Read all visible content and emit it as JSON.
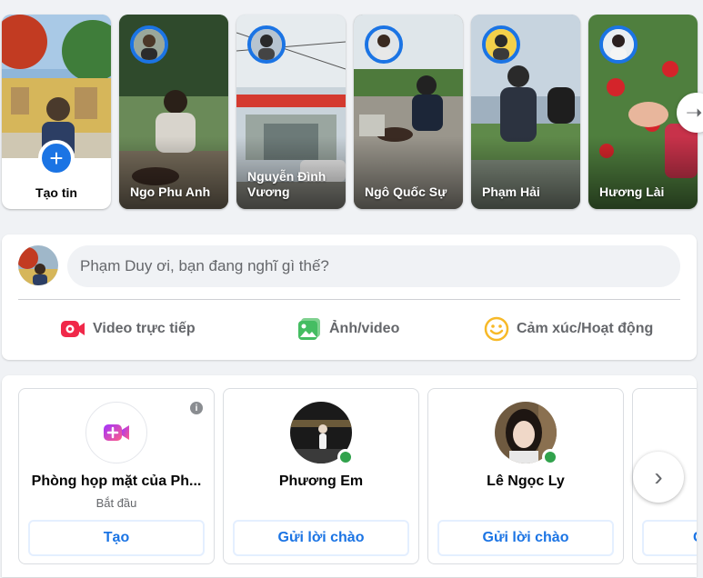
{
  "stories": {
    "create_label": "Tạo tin",
    "items": [
      {
        "name": "Ngo Phu Anh"
      },
      {
        "name": "Nguyễn Đình Vương"
      },
      {
        "name": "Ngô Quốc Sự"
      },
      {
        "name": "Phạm Hải"
      },
      {
        "name": "Hương Lài"
      }
    ],
    "next_icon": "arrow-right-icon"
  },
  "composer": {
    "placeholder": "Phạm Duy ơi, bạn đang nghĩ gì thế?",
    "actions": [
      {
        "label": "Video trực tiếp",
        "icon": "live-video-icon",
        "color": "#f02849"
      },
      {
        "label": "Ảnh/video",
        "icon": "photo-icon",
        "color": "#45bd62"
      },
      {
        "label": "Cảm xúc/Hoạt động",
        "icon": "feeling-icon",
        "color": "#f7b928"
      }
    ]
  },
  "rooms": {
    "create_card": {
      "title": "Phòng họp mặt của Ph...",
      "subtitle": "Bắt đầu",
      "button": "Tạo"
    },
    "friends": [
      {
        "name": "Phương Em",
        "button": "Gửi lời chào"
      },
      {
        "name": "Lê Ngọc Ly",
        "button": "Gửi lời chào"
      }
    ],
    "partial_label": "G",
    "partial_button": "G"
  },
  "colors": {
    "accent": "#1b74e4",
    "online": "#31a24c",
    "background": "#f0f2f5"
  }
}
